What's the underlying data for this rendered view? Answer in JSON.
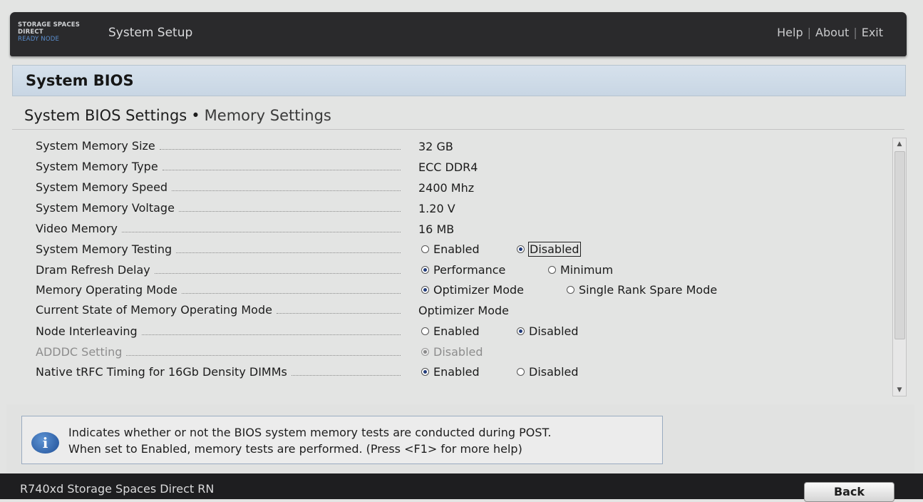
{
  "header": {
    "brand_line1": "STORAGE SPACES",
    "brand_line2": "DIRECT",
    "brand_line3": "READY NODE",
    "app_title": "System Setup",
    "links": {
      "help": "Help",
      "about": "About",
      "exit": "Exit"
    },
    "separator": "|"
  },
  "page": {
    "title": "System BIOS",
    "breadcrumb_parent": "System BIOS Settings",
    "breadcrumb_separator": "•",
    "breadcrumb_current": "Memory Settings"
  },
  "settings": [
    {
      "label": "System Memory Size",
      "value": "32 GB"
    },
    {
      "label": "System Memory Type",
      "value": "ECC DDR4"
    },
    {
      "label": "System Memory Speed",
      "value": "2400 Mhz"
    },
    {
      "label": "System Memory Voltage",
      "value": "1.20 V"
    },
    {
      "label": "Video Memory",
      "value": "16 MB"
    },
    {
      "label": "System Memory Testing",
      "options": [
        "Enabled",
        "Disabled"
      ],
      "selected": "Disabled"
    },
    {
      "label": "Dram Refresh Delay",
      "options": [
        "Performance",
        "Minimum"
      ],
      "selected": "Performance"
    },
    {
      "label": "Memory Operating Mode",
      "options": [
        "Optimizer Mode",
        "Single Rank Spare Mode"
      ],
      "selected": "Optimizer Mode"
    },
    {
      "label": "Current State of Memory Operating Mode",
      "value": "Optimizer Mode"
    },
    {
      "label": "Node Interleaving",
      "options": [
        "Enabled",
        "Disabled"
      ],
      "selected": "Disabled"
    },
    {
      "label": "ADDDC Setting",
      "options": [
        "Disabled"
      ],
      "selected": "Disabled",
      "disabled": true
    },
    {
      "label": "Native tRFC Timing for 16Gb Density DIMMs",
      "options": [
        "Enabled",
        "Disabled"
      ],
      "selected": "Enabled"
    }
  ],
  "help": {
    "icon": "info-icon",
    "line1": "Indicates whether or not the BIOS system memory tests are conducted during POST.",
    "line2": "When set to Enabled, memory tests are performed. (Press <F1> for more help)"
  },
  "footer": {
    "model": "R740xd Storage Spaces Direct RN",
    "back_label": "Back"
  },
  "colors": {
    "title_bar": "#2a2a2c",
    "header_band": "#d1dde9",
    "radio_selected": "#223c7a"
  }
}
